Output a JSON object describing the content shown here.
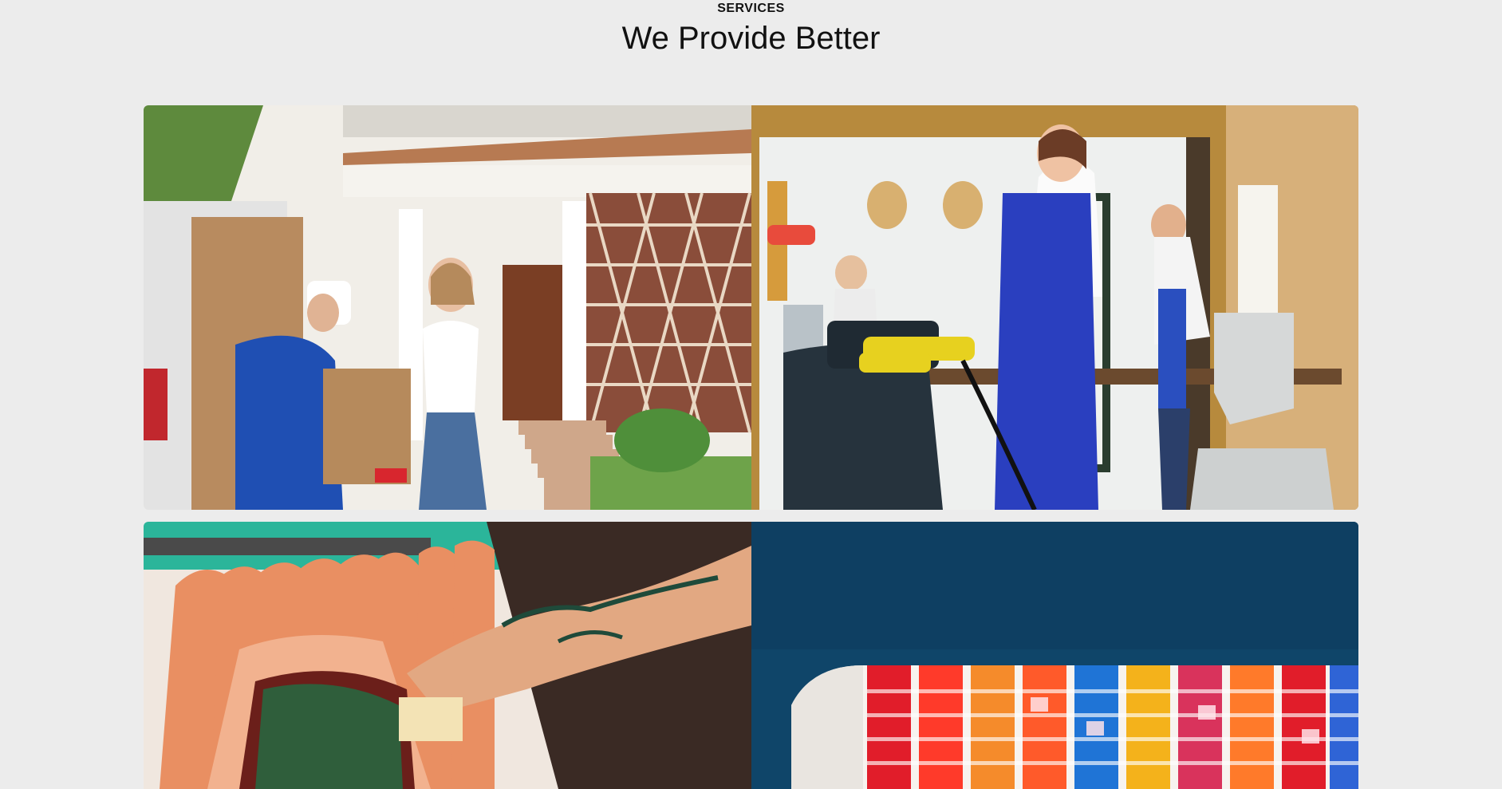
{
  "section": {
    "eyebrow": "SERVICES",
    "heading": "We Provide Better"
  },
  "cards": [
    {
      "image": "delivery-photo",
      "accent": "#1f4fb3"
    },
    {
      "image": "office-cleaning-photo",
      "accent": "#2a3fbf"
    },
    {
      "image": "clothing-rack-photo",
      "accent": "#2bb59a"
    },
    {
      "image": "container-ship-photo",
      "accent": "#0f4569"
    }
  ]
}
